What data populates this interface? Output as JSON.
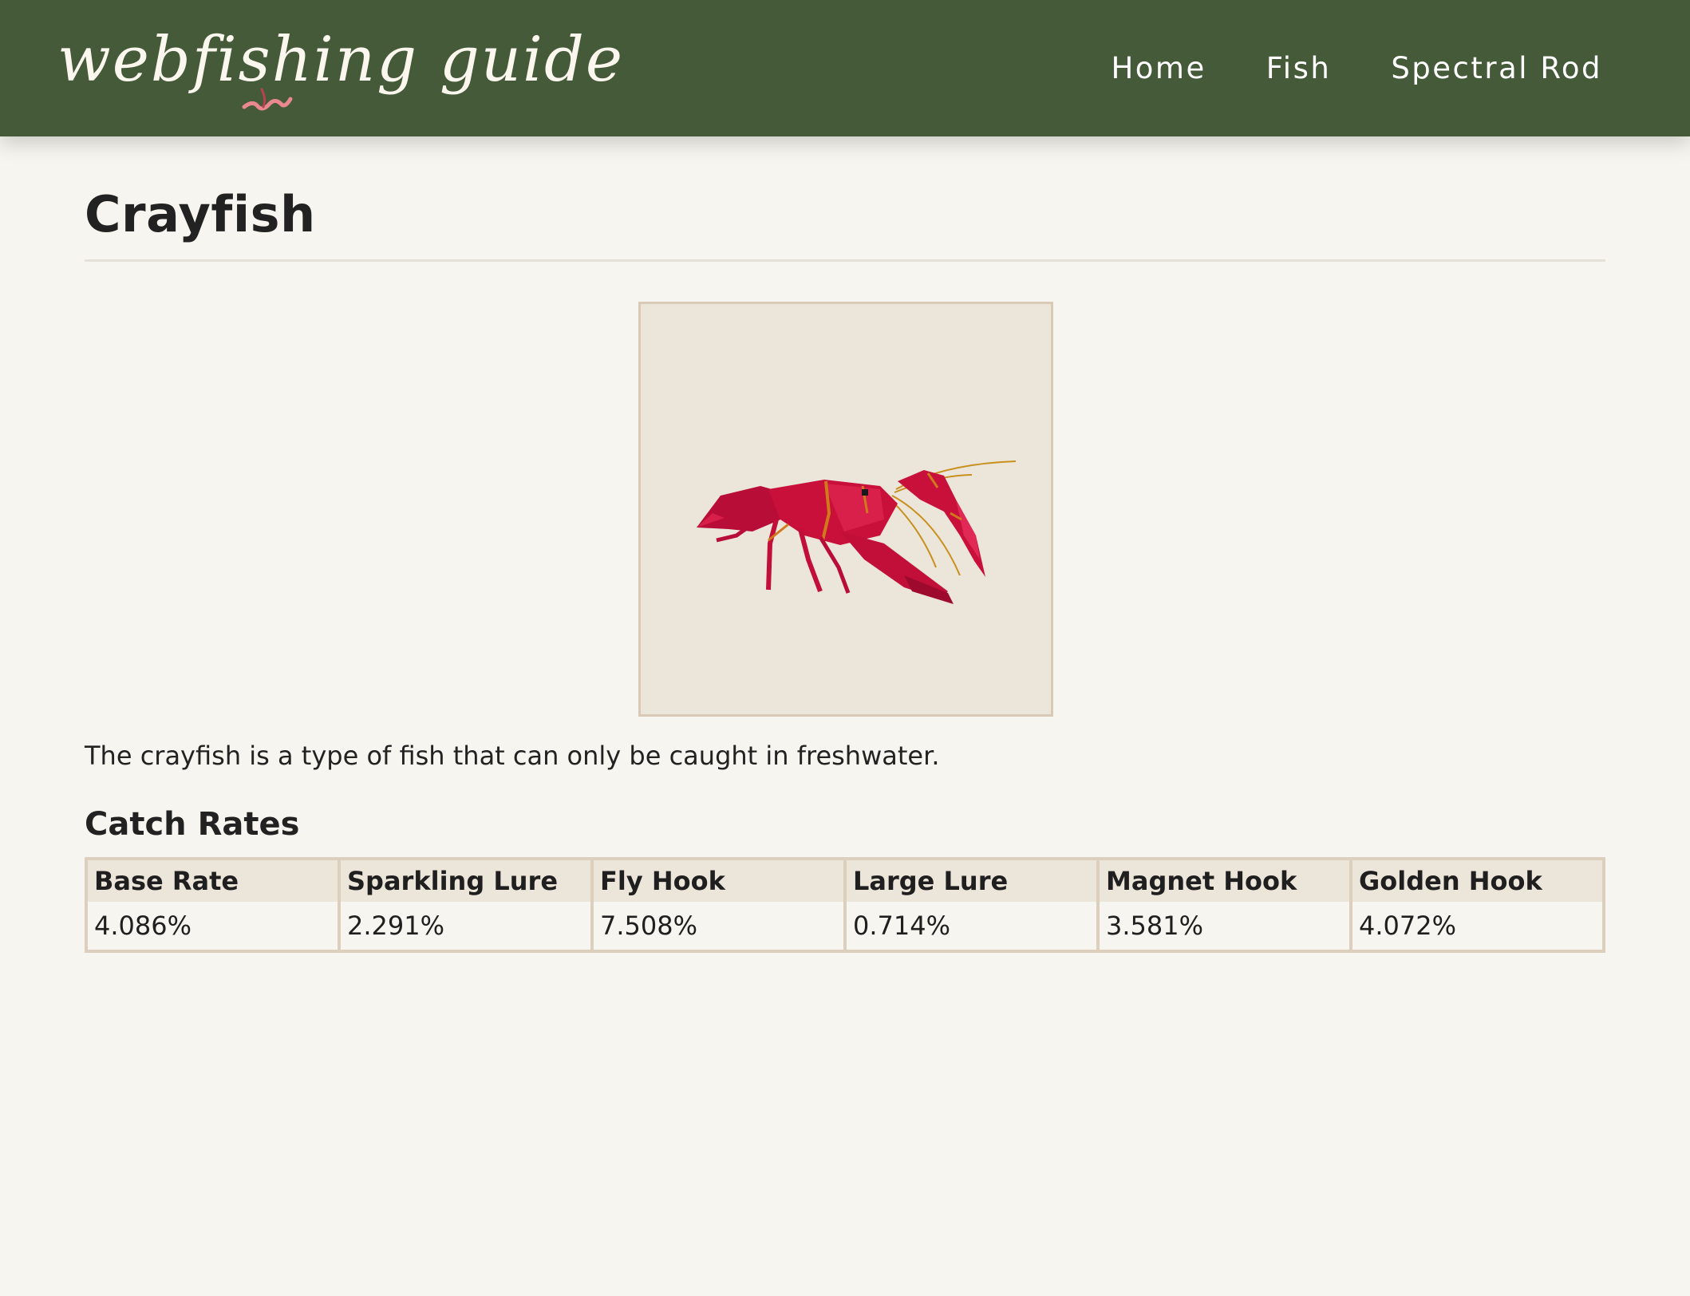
{
  "header": {
    "logo_text": "webfishing guide",
    "nav": [
      {
        "label": "Home"
      },
      {
        "label": "Fish"
      },
      {
        "label": "Spectral Rod"
      }
    ]
  },
  "main": {
    "title": "Crayfish",
    "description": "The crayfish is a type of fish that can only be caught in freshwater.",
    "catch_rates": {
      "heading": "Catch Rates",
      "columns": [
        "Base Rate",
        "Sparkling Lure",
        "Fly Hook",
        "Large Lure",
        "Magnet Hook",
        "Golden Hook"
      ],
      "values": [
        "4.086%",
        "2.291%",
        "7.508%",
        "0.714%",
        "3.581%",
        "4.072%"
      ]
    }
  },
  "colors": {
    "header_bg": "#455a39",
    "page_bg": "#f7f5ef",
    "table_border": "#dccfbd",
    "table_header_bg": "#ece5da",
    "crayfish_red": "#c8103a"
  },
  "icons": {
    "logo_worm": "worm-icon",
    "fish_image": "crayfish-image"
  }
}
